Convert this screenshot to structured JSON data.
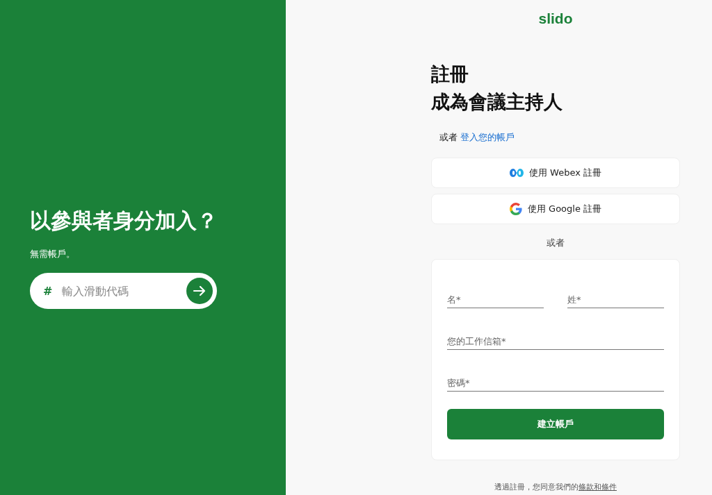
{
  "join": {
    "title": "以參與者身分加入？",
    "subtitle": "無需帳戶。",
    "code_field": {
      "prefix": "#",
      "placeholder": "輸入滑動代碼"
    }
  },
  "logo": "slido",
  "signup": {
    "title_lines": [
      "註冊",
      "成為會議主持人"
    ],
    "alt": {
      "text": "或者",
      "link": "登入您的帳戶"
    },
    "sso_buttons": [
      {
        "kind": "webex",
        "label": "使用 Webex 註冊"
      },
      {
        "kind": "google",
        "label": "使用 Google 註冊"
      }
    ],
    "divider": "或者",
    "form": {
      "rows": [
        {
          "fields": [
            {
              "placeholder": "名*"
            },
            {
              "placeholder": "姓*"
            }
          ]
        },
        {
          "fields": [
            {
              "placeholder": "您的工作信箱*"
            }
          ]
        },
        {
          "fields": [
            {
              "placeholder": "密碼*"
            }
          ]
        }
      ],
      "submit": "建立帳戶"
    },
    "terms": {
      "text": "透過註冊，您同意我們的",
      "link": "條款和條件"
    }
  }
}
